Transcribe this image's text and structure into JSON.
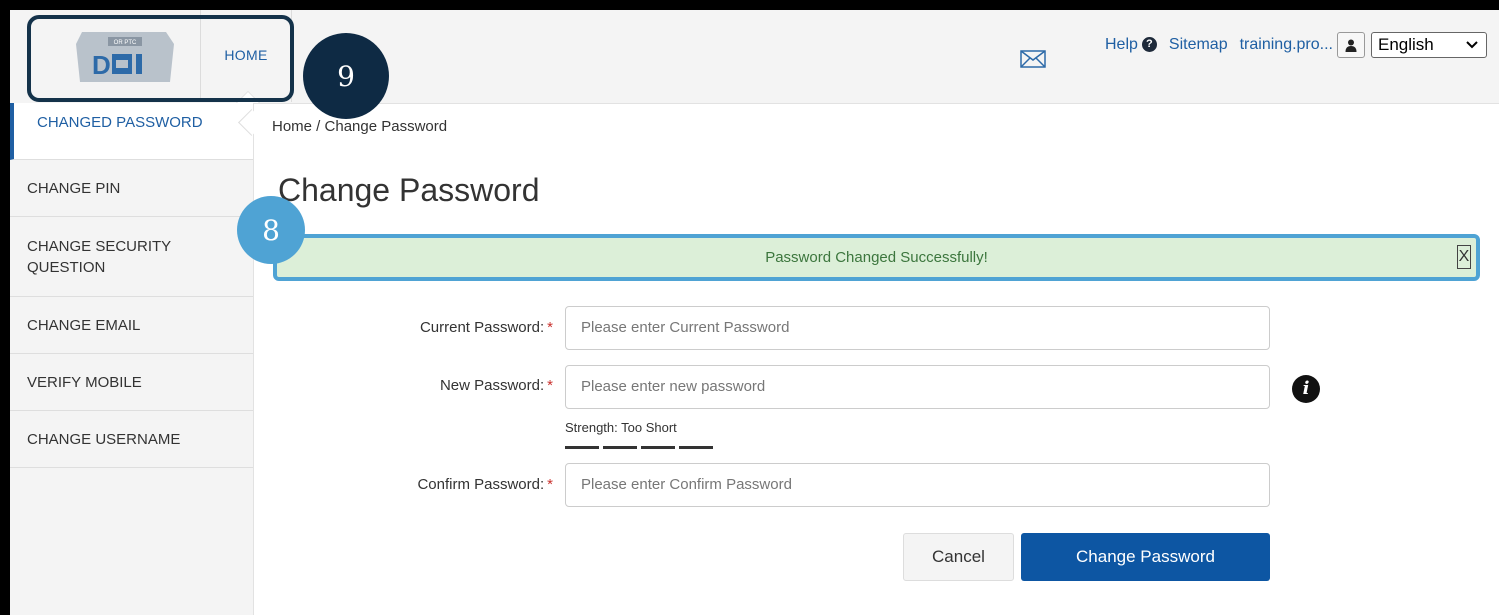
{
  "header": {
    "logo_text": "OR PTC DCI",
    "home_tab": "HOME",
    "links": {
      "help": "Help",
      "sitemap": "Sitemap",
      "username": "training.pro..."
    },
    "language": "English"
  },
  "callouts": {
    "nine": "9",
    "eight": "8"
  },
  "sidebar": {
    "items": [
      {
        "label": "CHANGED PASSWORD",
        "active": true
      },
      {
        "label": "CHANGE PIN"
      },
      {
        "label": "CHANGE SECURITY QUESTION"
      },
      {
        "label": "CHANGE EMAIL"
      },
      {
        "label": "VERIFY MOBILE"
      },
      {
        "label": "CHANGE USERNAME"
      }
    ]
  },
  "main": {
    "breadcrumb": "Home / Change Password",
    "title": "Change Password",
    "alert": {
      "text": "Password Changed Successfully!",
      "close": "X"
    },
    "form": {
      "current_label": "Current Password:",
      "current_placeholder": "Please enter Current Password",
      "new_label": "New Password:",
      "new_placeholder": "Please enter new password",
      "confirm_label": "Confirm Password:",
      "confirm_placeholder": "Please enter Confirm Password",
      "required_marker": "*",
      "strength_text": "Strength: Too Short"
    },
    "buttons": {
      "cancel": "Cancel",
      "submit": "Change Password"
    }
  },
  "colors": {
    "accent": "#1f5fa3",
    "primary_button": "#0d56a3",
    "alert_bg": "#dcefd8",
    "alert_text": "#3c763d",
    "callout_dark": "#0e2a44",
    "callout_light": "#4fa3d4"
  }
}
